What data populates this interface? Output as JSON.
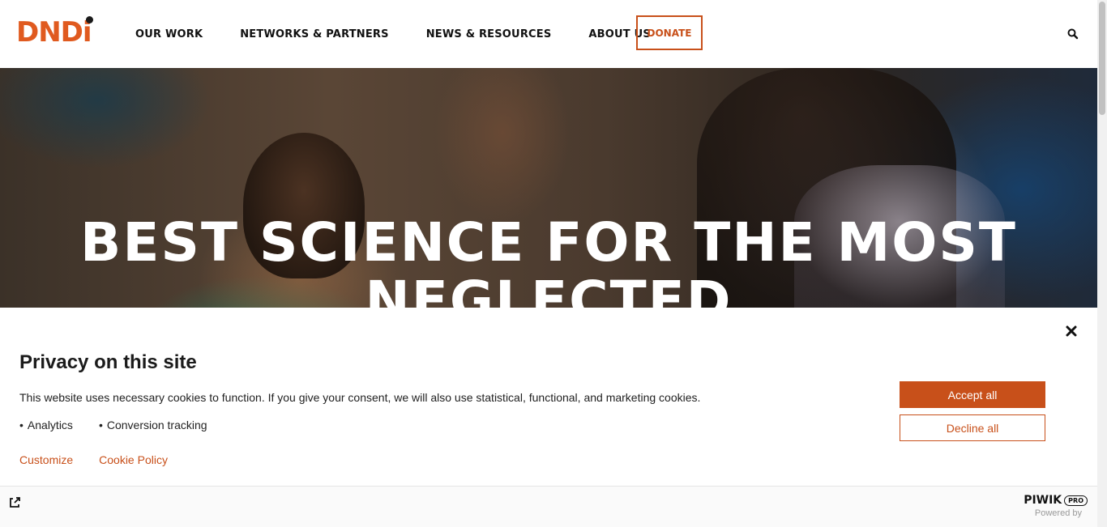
{
  "colors": {
    "brand": "#e05a1f",
    "accent": "#c8501a",
    "logo_dot": "#1a1a1a"
  },
  "header": {
    "logo": "DNDi",
    "nav": [
      "OUR WORK",
      "NETWORKS & PARTNERS",
      "NEWS & RESOURCES",
      "ABOUT US"
    ],
    "donate_label": "DONATE",
    "search_icon": "search-icon"
  },
  "hero": {
    "title": "BEST SCIENCE FOR THE MOST NEGLECTED"
  },
  "consent": {
    "title": "Privacy on this site",
    "text": "This website uses necessary cookies to function. If you give your consent, we will also use statistical, functional, and marketing cookies.",
    "purposes": [
      "Analytics",
      "Conversion tracking"
    ],
    "customize_label": "Customize",
    "policy_label": "Cookie Policy",
    "accept_label": "Accept all",
    "decline_label": "Decline all",
    "close_icon": "close-icon"
  },
  "footer": {
    "brand": "PIWIK",
    "brand_badge": "PRO",
    "powered_by": "Powered by",
    "external_icon": "external-link-icon"
  }
}
